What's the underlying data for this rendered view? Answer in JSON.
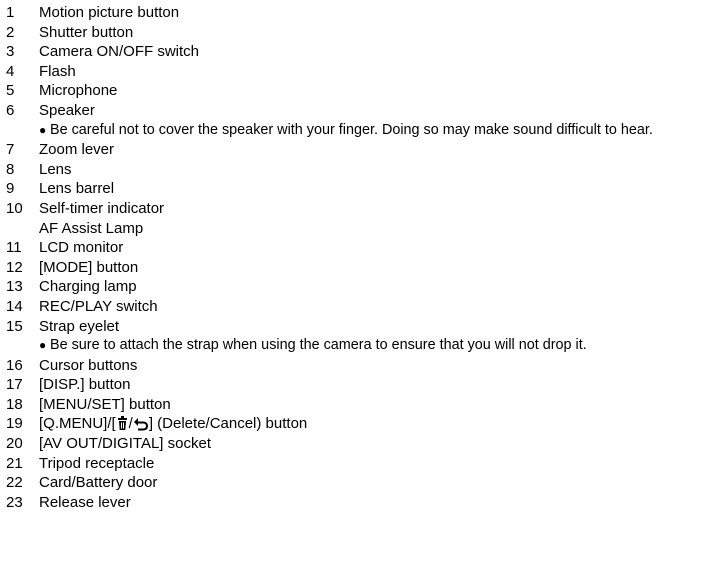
{
  "items": [
    {
      "num": "1",
      "label": "Motion picture button"
    },
    {
      "num": "2",
      "label": "Shutter button"
    },
    {
      "num": "3",
      "label": "Camera ON/OFF switch"
    },
    {
      "num": "4",
      "label": "Flash"
    },
    {
      "num": "5",
      "label": "Microphone"
    },
    {
      "num": "6",
      "label": "Speaker"
    },
    {
      "note": "Be careful not to cover the speaker with your finger. Doing so may make sound difficult to hear."
    },
    {
      "num": "7",
      "label": "Zoom lever"
    },
    {
      "num": "8",
      "label": "Lens"
    },
    {
      "num": "9",
      "label": "Lens barrel"
    },
    {
      "num": "10",
      "label": "Self-timer indicator"
    },
    {
      "num": "",
      "label": "AF Assist Lamp"
    },
    {
      "num": "11",
      "label": "LCD monitor"
    },
    {
      "num": "12",
      "label": "[MODE] button"
    },
    {
      "num": "13",
      "label": "Charging lamp"
    },
    {
      "num": "14",
      "label": "REC/PLAY switch"
    },
    {
      "num": "15",
      "label": "Strap eyelet"
    },
    {
      "note": "Be sure to attach the strap when using the camera to ensure that you will not drop it."
    },
    {
      "num": "16",
      "label": "Cursor buttons"
    },
    {
      "num": "17",
      "label": "[DISP.] button"
    },
    {
      "num": "18",
      "label": "[MENU/SET] button"
    },
    {
      "num": "19",
      "label_prefix": "[Q.MENU]/[",
      "label_suffix": "] (Delete/Cancel) button",
      "icons": [
        "trash-icon",
        "return-icon"
      ]
    },
    {
      "num": "20",
      "label": "[AV OUT/DIGITAL] socket"
    },
    {
      "num": "21",
      "label": "Tripod receptacle"
    },
    {
      "num": "22",
      "label": "Card/Battery door"
    },
    {
      "num": "23",
      "label": "Release lever"
    }
  ]
}
